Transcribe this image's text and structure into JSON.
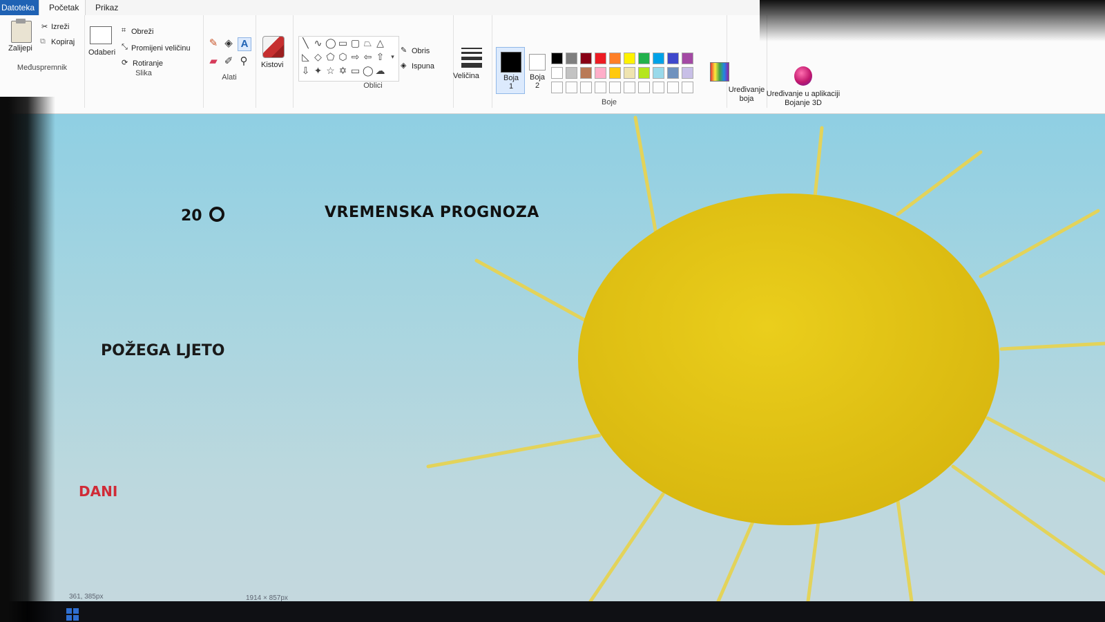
{
  "tabs": {
    "file": "Datoteka",
    "home": "Početak",
    "view": "Prikaz"
  },
  "clipboard": {
    "paste": "Zalijepi",
    "cut": "Izreži",
    "copy": "Kopiraj",
    "group": "Međuspremnik"
  },
  "image": {
    "select": "Odaberi",
    "crop": "Obreži",
    "resize": "Promijeni veličinu",
    "rotate": "Rotiranje",
    "group": "Slika"
  },
  "tools": {
    "group": "Alati"
  },
  "brushes": {
    "label": "Kistovi"
  },
  "shapes": {
    "outline": "Obris",
    "fill": "Ispuna",
    "group": "Oblici"
  },
  "size": {
    "label": "Veličina"
  },
  "colors": {
    "color1": "Boja 1",
    "color2": "Boja 2",
    "group": "Boje",
    "edit_colors": "Uređivanje boja",
    "paint3d": "Uređivanje u aplikaciji Bojanje 3D",
    "palette_row1": [
      "#000000",
      "#7f7f7f",
      "#880015",
      "#ed1c24",
      "#ff7f27",
      "#fff200",
      "#22b14c",
      "#00a2e8",
      "#3f48cc",
      "#a349a4"
    ],
    "palette_row2": [
      "#ffffff",
      "#c3c3c3",
      "#b97a57",
      "#ffaec9",
      "#ffc90e",
      "#efe4b0",
      "#b5e61d",
      "#99d9ea",
      "#7092be",
      "#c8bfe7"
    ]
  },
  "canvas": {
    "temperature": "20",
    "title": "VREMENSKA PROGNOZA",
    "city": "POŽEGA LJETO",
    "days": "DANI",
    "sun_color": "#e8c81a",
    "sky_color": "#9fd2e0"
  },
  "status": {
    "cursor": "361, 385px",
    "size": "1914 × 857px"
  }
}
